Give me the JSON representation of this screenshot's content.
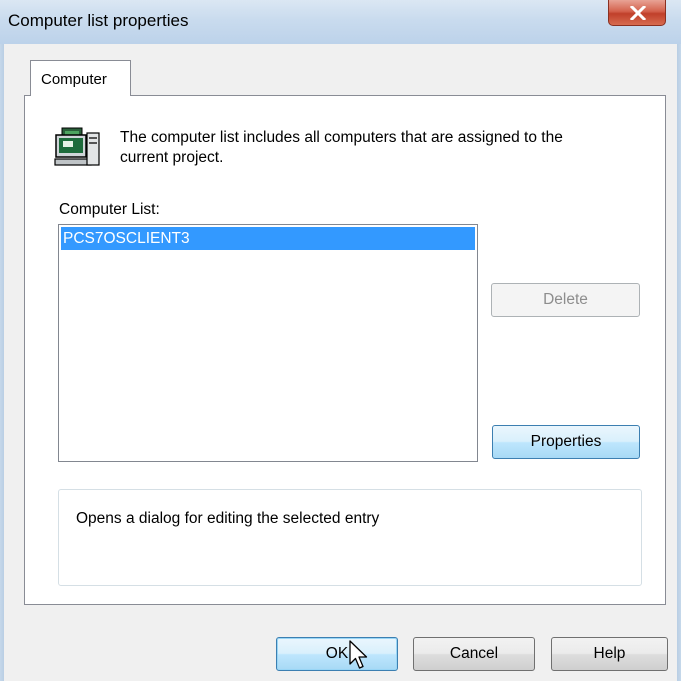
{
  "window": {
    "title": "Computer list properties",
    "close_glyph": "X"
  },
  "tabs": [
    {
      "label": "Computer",
      "active": true
    }
  ],
  "panel": {
    "icon": "computer-icon",
    "description_line1": "The computer list includes all computers that are assigned to the",
    "description_line2": "current project.",
    "list_label": "Computer List:",
    "list_items": [
      "PCS7OSCLIENT3"
    ],
    "selected_index": 0,
    "delete_label": "Delete",
    "properties_label": "Properties",
    "help_text": "Opens a dialog for editing the selected entry"
  },
  "footer": {
    "ok_label": "OK",
    "cancel_label": "Cancel",
    "help_label": "Help"
  },
  "colors": {
    "selection": "#3399ff",
    "close_button": "#c0402b",
    "titlebar": "#c9dbee"
  }
}
